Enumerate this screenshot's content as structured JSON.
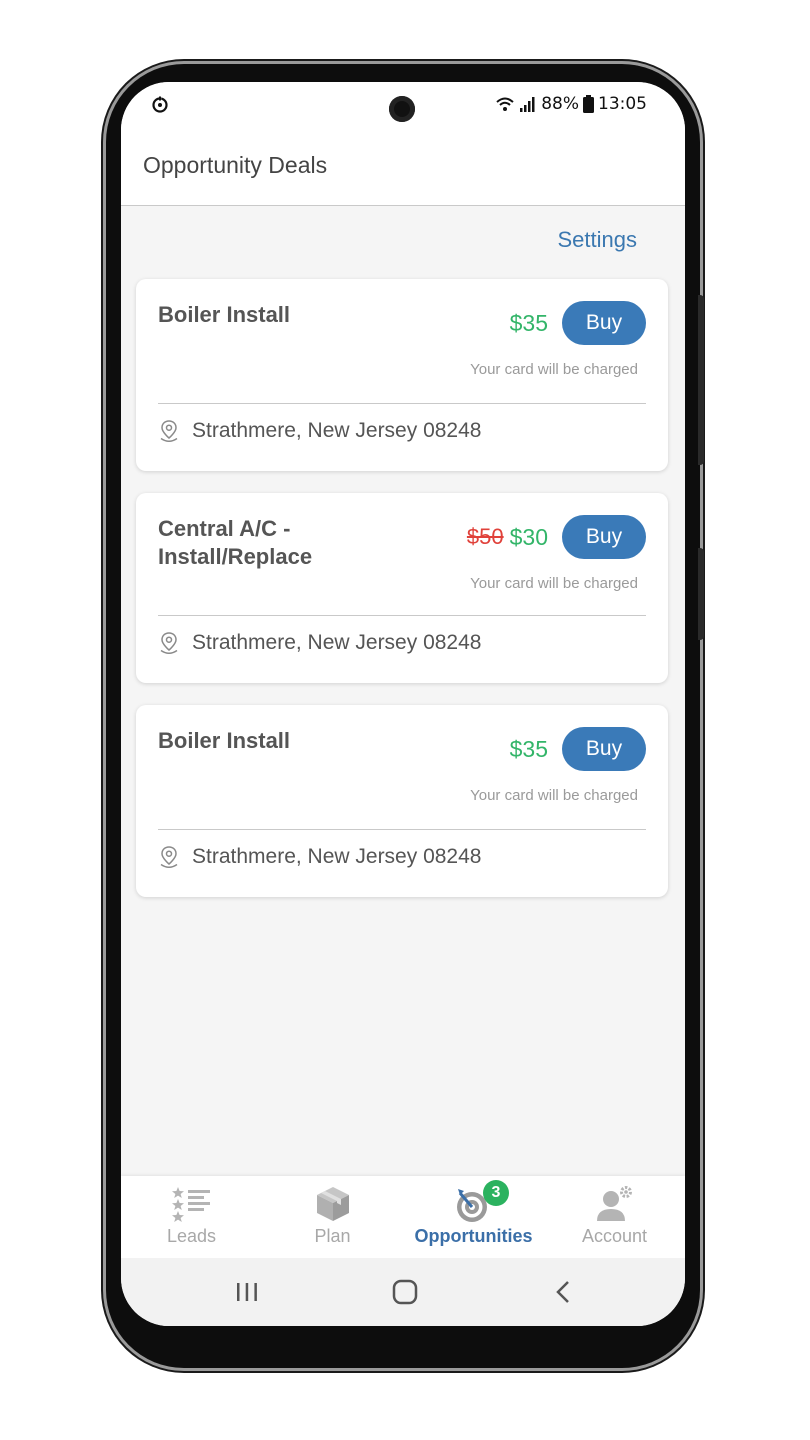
{
  "status_bar": {
    "battery": "88%",
    "time": "13:05"
  },
  "app_bar": {
    "title": "Opportunity Deals"
  },
  "settings_link": "Settings",
  "deals": [
    {
      "title": "Boiler Install",
      "old_price": "",
      "price": "$35",
      "buy_label": "Buy",
      "note": "Your card will be charged",
      "location": "Strathmere, New Jersey 08248"
    },
    {
      "title": "Central A/C - Install/Replace",
      "old_price": "$50",
      "price": "$30",
      "buy_label": "Buy",
      "note": "Your card will be charged",
      "location": "Strathmere, New Jersey 08248"
    },
    {
      "title": "Boiler Install",
      "old_price": "",
      "price": "$35",
      "buy_label": "Buy",
      "note": "Your card will be charged",
      "location": "Strathmere, New Jersey 08248"
    }
  ],
  "bottom_nav": {
    "items": [
      {
        "label": "Leads",
        "icon": "leads-list-icon"
      },
      {
        "label": "Plan",
        "icon": "package-icon"
      },
      {
        "label": "Opportunities",
        "icon": "target-icon",
        "badge": "3",
        "active": true
      },
      {
        "label": "Account",
        "icon": "account-settings-icon"
      }
    ]
  },
  "colors": {
    "primary": "#3a7ab8",
    "price": "#33b569",
    "discount": "#e0413a",
    "badge": "#2bb25f"
  }
}
